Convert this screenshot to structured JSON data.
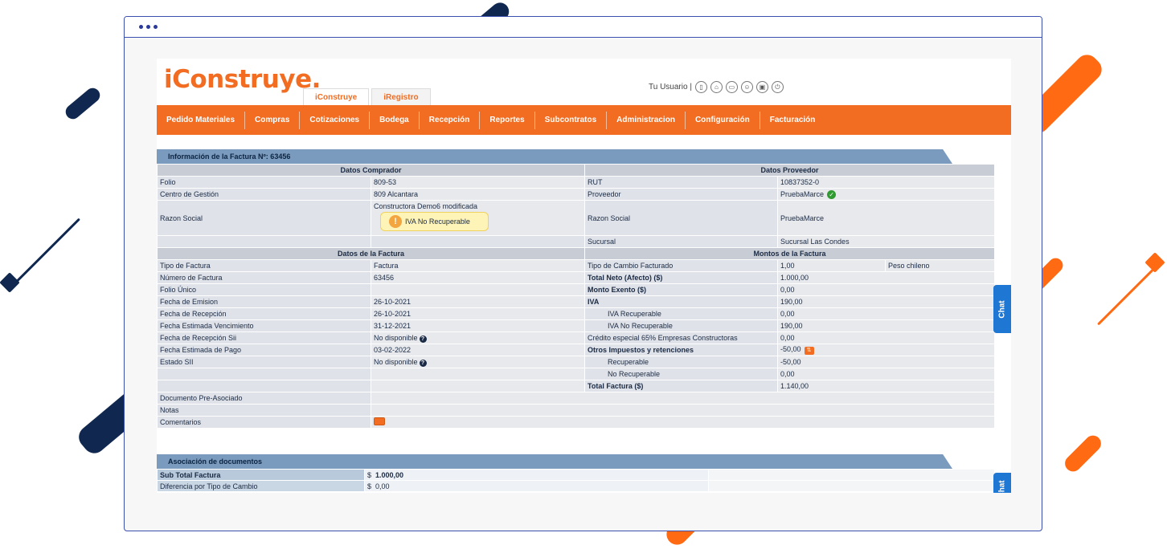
{
  "app": {
    "logo": "iConstruye.",
    "tabs": [
      "iConstruye",
      "iRegistro"
    ],
    "user_label": "Tu Usuario |",
    "user_icons": [
      "document-icon",
      "home-icon",
      "print-icon",
      "user-icon",
      "lock-icon",
      "power-icon"
    ],
    "nav": [
      "Pedido Materiales",
      "Compras",
      "Cotizaciones",
      "Bodega",
      "Recepción",
      "Reportes",
      "Subcontratos",
      "Administracion",
      "Configuración",
      "Facturación"
    ],
    "chat_label": "Chat"
  },
  "invoice": {
    "section_title": "Información de la Factura Nº: 63456",
    "comprador_header": "Datos Comprador",
    "proveedor_header": "Datos Proveedor",
    "folio_label": "Folio",
    "folio": "809-53",
    "rut_label": "RUT",
    "rut": "10837352-0",
    "centro_label": "Centro de Gestión",
    "centro": "809 Alcantara",
    "proveedor_label": "Proveedor",
    "proveedor": "PruebaMarce",
    "razon_label": "Razon Social",
    "razon_comprador": "Constructora Demo6 modificada",
    "iva_warning": "IVA No Recuperable",
    "razon_proveedor": "PruebaMarce",
    "sucursal_label": "Sucursal",
    "sucursal": "Sucursal Las Condes",
    "datos_factura_header": "Datos de la Factura",
    "montos_header": "Montos de la Factura",
    "left_rows": [
      {
        "label": "Tipo de Factura",
        "value": "Factura"
      },
      {
        "label": "Número de Factura",
        "value": "63456"
      },
      {
        "label": "Folio Único",
        "value": ""
      },
      {
        "label": "Fecha de Emision",
        "value": "26-10-2021"
      },
      {
        "label": "Fecha de Recepción",
        "value": "26-10-2021"
      },
      {
        "label": "Fecha Estimada Vencimiento",
        "value": "31-12-2021"
      },
      {
        "label": "Fecha de Recepción Sii",
        "value": "No disponible"
      },
      {
        "label": "Fecha Estimada de Pago",
        "value": "03-02-2022"
      },
      {
        "label": "Estado SII",
        "value": "No disponible"
      }
    ],
    "right_rows": [
      {
        "label": "Tipo de Cambio Facturado",
        "value": "1,00",
        "extra": "Peso chileno"
      },
      {
        "label": "Total Neto (Afecto) ($)",
        "value": "1.000,00"
      },
      {
        "label": "Monto Exento ($)",
        "value": "0,00"
      },
      {
        "label": "IVA",
        "value": "190,00"
      },
      {
        "label": "IVA Recuperable",
        "value": "0,00"
      },
      {
        "label": "IVA No Recuperable",
        "value": "190,00"
      },
      {
        "label": "Crédito especial 65% Empresas Constructoras",
        "value": "0,00"
      },
      {
        "label": "Otros Impuestos y retenciones",
        "value": "-50,00"
      },
      {
        "label": "Recuperable",
        "value": "-50,00"
      },
      {
        "label": "No Recuperable",
        "value": "0,00"
      },
      {
        "label": "Total Factura ($)",
        "value": "1.140,00"
      }
    ],
    "doc_preasociado_label": "Documento Pre-Asociado",
    "notas_label": "Notas",
    "comentarios_label": "Comentarios"
  },
  "assoc": {
    "section_title": "Asociación de documentos",
    "subtotal_label": "Sub Total Factura",
    "currency": "$",
    "subtotal": "1.000,00",
    "diferencia_label": "Diferencia por Tipo de Cambio",
    "diferencia": "0,00"
  },
  "colors": {
    "brand_orange": "#f26c21",
    "section_blue": "#7a9bbd",
    "frame_blue": "#3a4fb0",
    "chat_blue": "#1f77d4",
    "deco_navy": "#10284f"
  }
}
